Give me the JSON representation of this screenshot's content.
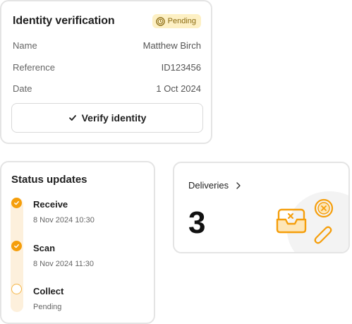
{
  "identity": {
    "title": "Identity verification",
    "status_badge": "Pending",
    "rows": [
      {
        "label": "Name",
        "value": "Matthew Birch"
      },
      {
        "label": "Reference",
        "value": "ID123456"
      },
      {
        "label": "Date",
        "value": "1 Oct 2024"
      }
    ],
    "verify_button": "Verify identity"
  },
  "status": {
    "title": "Status updates",
    "steps": [
      {
        "name": "Receive",
        "detail": "8 Nov 2024 10:30",
        "state": "done"
      },
      {
        "name": "Scan",
        "detail": "8 Nov 2024 11:30",
        "state": "done"
      },
      {
        "name": "Collect",
        "detail": "Pending",
        "state": "pending"
      }
    ]
  },
  "deliveries": {
    "label": "Deliveries",
    "count": "3"
  },
  "colors": {
    "accent": "#f59e0b",
    "badge_bg": "#fdf0c4",
    "badge_text": "#8a6a10",
    "border": "#e4e4e4"
  },
  "icons": {
    "badge": "pending-clock-icon",
    "verify": "check-icon",
    "link": "chevron-right-icon",
    "illustration": [
      "empty-tray-icon",
      "cancel-circle-icon",
      "paperclip-icon"
    ]
  }
}
